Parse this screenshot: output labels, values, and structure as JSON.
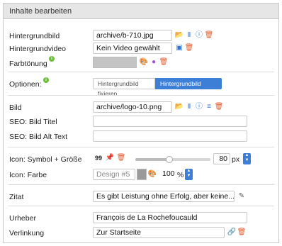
{
  "panel": {
    "title": "Inhalte bearbeiten"
  },
  "rows": {
    "hintergrundbild": {
      "label": "Hintergrundbild",
      "value": "archive/b-710.jpg"
    },
    "hintergrundvideo": {
      "label": "Hintergrundvideo",
      "value": "Kein Video gewählt"
    },
    "farbtoenung": {
      "label": "Farbtönung",
      "info": "i"
    },
    "optionen": {
      "label": "Optionen:",
      "info": "i",
      "option_fixed": "Hintergrundbild fixieren",
      "option_scroll": "Hintergrundbild scrollen",
      "selected": "Hintergrundbild scrollen"
    },
    "bild": {
      "label": "Bild",
      "value": "archive/logo-10.png"
    },
    "seo_titel": {
      "label": "SEO: Bild Titel",
      "value": ""
    },
    "seo_alt": {
      "label": "SEO: Bild Alt Text",
      "value": ""
    },
    "icon_symbol": {
      "label": "Icon: Symbol + Größe",
      "quote_glyph": "99",
      "size_value": "80",
      "unit": "px",
      "slider_fraction": 0.45
    },
    "icon_farbe": {
      "label": "Icon: Farbe",
      "design_placeholder": "Design #5",
      "opacity_value": "100",
      "opacity_unit": "%"
    },
    "zitat": {
      "label": "Zitat",
      "value": "Es gibt Leistung ohne Erfolg, aber keine..."
    },
    "urheber": {
      "label": "Urheber",
      "value": "François de La Rochefoucauld"
    },
    "verlinkung": {
      "label": "Verlinkung",
      "value": "Zur Startseite"
    }
  },
  "colors": {
    "accent": "#3d7fd6",
    "trash": "#e25a2b",
    "folder": "#3aa53a",
    "info": "#6cbf3a",
    "swatch_grey": "#c4c4c4"
  },
  "icons": [
    "folder-icon",
    "library-icon",
    "info-circle-icon",
    "trash-icon",
    "video-select-icon",
    "palette-icon",
    "color-wheel-icon",
    "adjust-icon",
    "pin-icon",
    "spinner-icon",
    "edit-pencil-icon",
    "link-icon"
  ]
}
